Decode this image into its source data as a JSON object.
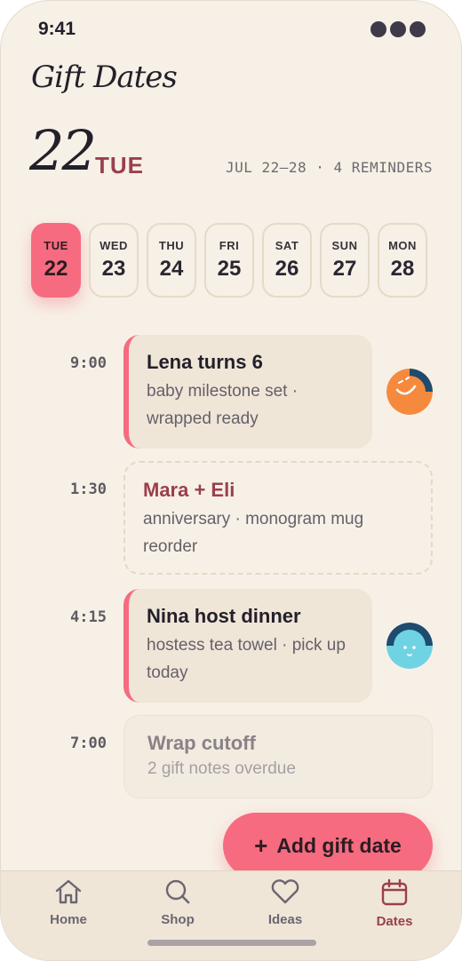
{
  "status": {
    "time": "9:41"
  },
  "header": {
    "title": "Gift Dates",
    "date_num": "22",
    "date_day": "TUE",
    "range": "JUL 22–28 · 4 REMINDERS"
  },
  "week": [
    {
      "name": "TUE",
      "num": "22",
      "selected": true
    },
    {
      "name": "WED",
      "num": "23"
    },
    {
      "name": "THU",
      "num": "24"
    },
    {
      "name": "FRI",
      "num": "25"
    },
    {
      "name": "SAT",
      "num": "26"
    },
    {
      "name": "SUN",
      "num": "27"
    },
    {
      "name": "MON",
      "num": "28"
    }
  ],
  "events": [
    {
      "time": "9:00",
      "title": "Lena turns 6",
      "subtitle": "baby milestone set · wrapped ready",
      "style": "accent",
      "avatar": "smiling-face-icon"
    },
    {
      "time": "1:30",
      "title": "Mara + Eli",
      "subtitle": "anniversary · monogram mug reorder",
      "style": "dashed",
      "title_color": "#9a3f4c"
    },
    {
      "time": "4:15",
      "title": "Nina host dinner",
      "subtitle": "hostess tea towel · pick up today",
      "style": "accent",
      "avatar": "calm-face-icon"
    },
    {
      "time": "7:00",
      "title": "Wrap cutoff",
      "subtitle": "2 gift notes overdue",
      "style": "muted"
    }
  ],
  "fab": {
    "icon": "+",
    "label": "Add gift date"
  },
  "nav": [
    {
      "label": "Home",
      "icon": "home-icon"
    },
    {
      "label": "Shop",
      "icon": "search-icon"
    },
    {
      "label": "Ideas",
      "icon": "heart-icon"
    },
    {
      "label": "Dates",
      "icon": "calendar-icon",
      "active": true
    }
  ],
  "colors": {
    "accent": "#f66b7f",
    "accent_text": "#9a3f4c",
    "background": "#f7f0e6",
    "card": "#efe6d8"
  }
}
